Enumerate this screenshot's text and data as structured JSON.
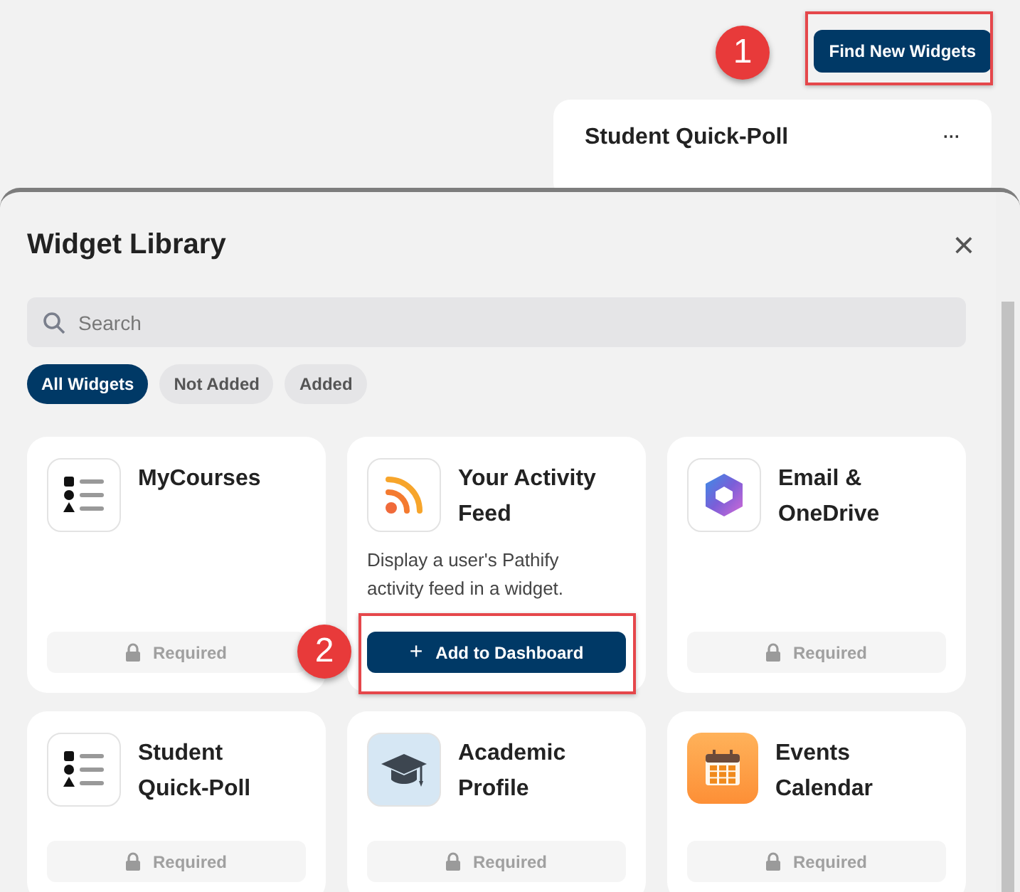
{
  "header": {
    "button": "Find New Widgets",
    "annotation": "1"
  },
  "background_card": {
    "title": "Student Quick-Poll",
    "menu": "···"
  },
  "modal": {
    "title": "Widget Library",
    "close": "×",
    "search": {
      "placeholder": "Search"
    },
    "filters": [
      {
        "label": "All Widgets",
        "selected": true
      },
      {
        "label": "Not Added",
        "selected": false
      },
      {
        "label": "Added",
        "selected": false
      }
    ],
    "widgets": [
      {
        "title": "MyCourses",
        "kind": "required",
        "action": "Required"
      },
      {
        "title": "Your Activity Feed",
        "kind": "addable",
        "description": "Display a user's Pathify activity feed in a widget.",
        "action": "Add to Dashboard",
        "action_icon": "+",
        "annotation": "2"
      },
      {
        "title": "Email & OneDrive",
        "kind": "required",
        "action": "Required"
      },
      {
        "title": "Student Quick-Poll",
        "kind": "required",
        "action": "Required"
      },
      {
        "title": "Academic Profile",
        "kind": "required",
        "action": "Required"
      },
      {
        "title": "Events Calendar",
        "kind": "required",
        "action": "Required"
      }
    ]
  }
}
